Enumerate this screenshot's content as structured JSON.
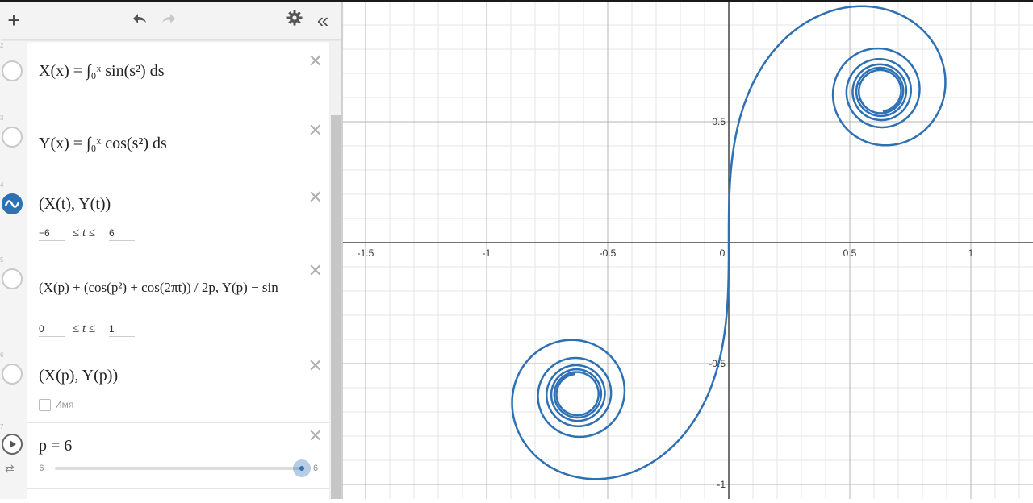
{
  "toolbar": {
    "add_icon": "plus-icon",
    "undo_icon": "undo-icon",
    "redo_icon": "redo-icon",
    "settings_icon": "gear-icon",
    "collapse_icon": "double-chevron-left-icon"
  },
  "expressions": [
    {
      "index": "2",
      "latex": "X(x) = ∫₀ˣ sin(s²) ds"
    },
    {
      "index": "3",
      "latex": "Y(x) = ∫₀ˣ cos(s²) ds"
    },
    {
      "index": "4",
      "latex": "(X(t), Y(t))",
      "lower": "−6",
      "var": "t",
      "upper": "6"
    },
    {
      "index": "5",
      "latex": "(X(p) + (cos(p²) + cos(2πt)) / 2p, Y(p) − sin",
      "lower": "0",
      "var": "t",
      "upper": "1"
    },
    {
      "index": "6",
      "latex": "(X(p), Y(p))",
      "label_checkbox": "Имя"
    },
    {
      "index": "7",
      "latex": "p = 6",
      "slider_min": "−6",
      "slider_max": "6",
      "slider_value": 6
    }
  ],
  "graph": {
    "x_ticks": [
      "-1.5",
      "-1",
      "-0.5",
      "0",
      "0.5",
      "1"
    ],
    "y_ticks": [
      "0.5",
      "-0.5",
      "-1"
    ],
    "curve_color": "#2d70b3",
    "slider_color": "#2d70b3"
  }
}
